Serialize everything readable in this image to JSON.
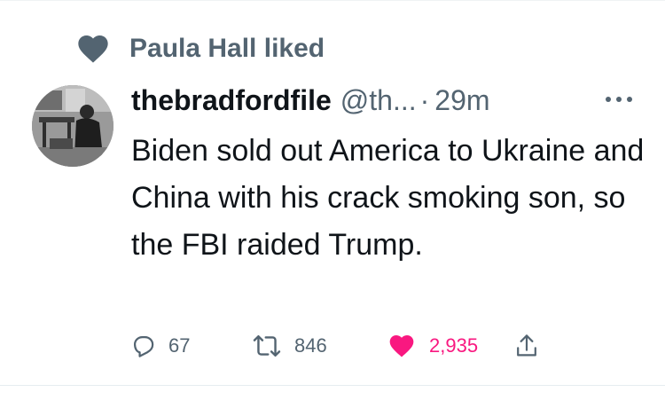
{
  "social_context": {
    "text": "Paula Hall liked",
    "icon": "heart-icon"
  },
  "tweet": {
    "display_name": "thebradfordfile",
    "handle": "@th...",
    "separator": "·",
    "time": "29m",
    "text": "Biden sold out America to Ukraine and China with his crack smoking son, so the FBI raided Trump.",
    "avatar_icon": "avatar-photo"
  },
  "actions": {
    "reply": {
      "count": "67",
      "icon": "reply-icon"
    },
    "retweet": {
      "count": "846",
      "icon": "retweet-icon"
    },
    "like": {
      "count": "2,935",
      "icon": "heart-filled-icon",
      "active": true
    },
    "share": {
      "icon": "share-icon"
    }
  },
  "colors": {
    "secondary_text": "#536471",
    "like_pink": "#f91880",
    "primary_text": "#0f1419"
  }
}
